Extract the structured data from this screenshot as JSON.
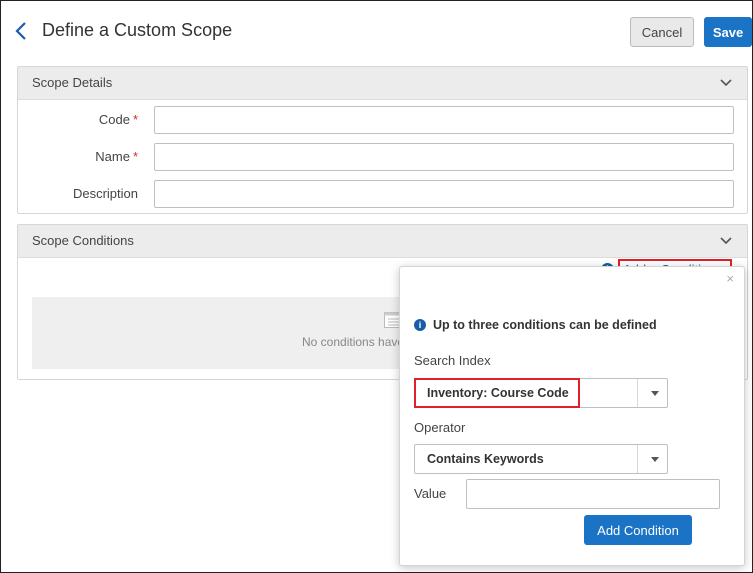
{
  "header": {
    "title": "Define a Custom Scope",
    "cancel_label": "Cancel",
    "save_label": "Save"
  },
  "scope_details": {
    "title": "Scope Details",
    "fields": [
      {
        "label": "Code",
        "required": true,
        "value": ""
      },
      {
        "label": "Name",
        "required": true,
        "value": ""
      },
      {
        "label": "Description",
        "required": false,
        "value": ""
      }
    ],
    "required_marker": "*"
  },
  "scope_conditions": {
    "title": "Scope Conditions",
    "add_condition_label": "Add a Condition",
    "empty_text": "No conditions have"
  },
  "popover": {
    "close_glyph": "×",
    "info_text": "Up to three conditions can be defined",
    "search_index_label": "Search Index",
    "search_index_value": "Inventory: Course Code",
    "operator_label": "Operator",
    "operator_value": "Contains Keywords",
    "value_label": "Value",
    "value_input": "",
    "add_button_label": "Add Condition"
  },
  "colors": {
    "primary": "#1a73c4",
    "link": "#1a5ca8",
    "required": "#d0302b",
    "highlight": "#e0202a"
  },
  "icons": [
    "back-chevron-icon",
    "chevron-down-icon",
    "plus-circle-icon",
    "caret-down-icon",
    "list-icon",
    "info-icon",
    "close-icon"
  ]
}
